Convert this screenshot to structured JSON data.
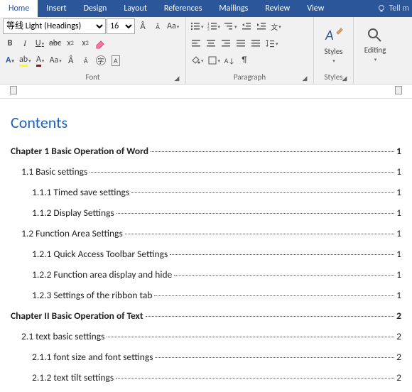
{
  "tabs": [
    "Home",
    "Insert",
    "Design",
    "Layout",
    "References",
    "Mailings",
    "Review",
    "View"
  ],
  "active_tab": 0,
  "tellme": "Tell m",
  "font": {
    "name": "等线 Light (Headings)",
    "size": "16"
  },
  "groups": {
    "font": "Font",
    "paragraph": "Paragraph",
    "styles": "Styles",
    "editing": "Editing"
  },
  "toc_title": "Contents",
  "toc": [
    {
      "lvl": 1,
      "txt": "Chapter 1 Basic Operation of Word",
      "pg": "1"
    },
    {
      "lvl": 2,
      "txt": "1.1 Basic settings",
      "pg": "1"
    },
    {
      "lvl": 3,
      "txt": "1.1.1 Timed save settings",
      "pg": "1"
    },
    {
      "lvl": 3,
      "txt": "1.1.2 Display Settings",
      "pg": "1"
    },
    {
      "lvl": 2,
      "txt": "1.2 Function Area Settings",
      "pg": "1"
    },
    {
      "lvl": 3,
      "txt": "1.2.1 Quick Access Toolbar Settings",
      "pg": "1"
    },
    {
      "lvl": 3,
      "txt": "1.2.2 Function area display and hide",
      "pg": "1"
    },
    {
      "lvl": 3,
      "txt": "1.2.3 Settings of the ribbon tab",
      "pg": "1"
    },
    {
      "lvl": 1,
      "txt": "Chapter II Basic Operation of Text",
      "pg": "2"
    },
    {
      "lvl": 2,
      "txt": "2.1 text basic settings",
      "pg": "2"
    },
    {
      "lvl": 3,
      "txt": "2.1.1 font size and font settings",
      "pg": "2"
    },
    {
      "lvl": 3,
      "txt": "2.1.2 text tilt settings",
      "pg": "2"
    }
  ]
}
